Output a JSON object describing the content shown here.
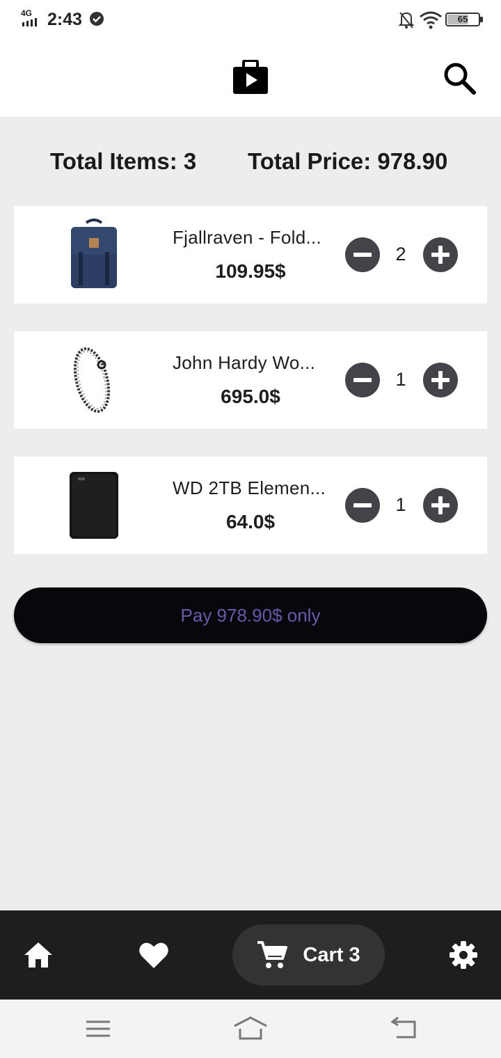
{
  "status_bar": {
    "network": "4G",
    "time": "2:43",
    "battery": "65"
  },
  "app_bar": {
    "logo_icon": "shopping-bag-play-icon",
    "search_icon": "search-icon"
  },
  "summary": {
    "total_items": "Total Items: 3",
    "total_price": "Total Price: 978.90"
  },
  "cart_items": [
    {
      "name": "Fjallraven - Fold...",
      "price": "109.95$",
      "quantity": "2",
      "thumb": "backpack-image"
    },
    {
      "name": "John Hardy Wo...",
      "price": "695.0$",
      "quantity": "1",
      "thumb": "bracelet-image"
    },
    {
      "name": "WD 2TB Elemen...",
      "price": "64.0$",
      "quantity": "1",
      "thumb": "hard-drive-image"
    }
  ],
  "pay_button": {
    "label": "Pay 978.90$ only"
  },
  "bottom_nav": {
    "home_icon": "home-icon",
    "favorites_icon": "heart-icon",
    "cart_label": "Cart 3",
    "cart_icon": "cart-icon",
    "settings_icon": "gear-icon"
  },
  "colors": {
    "accent_text": "#6a58ad",
    "qty_button": "#45424a",
    "nav_background": "#1e1e1e",
    "page_background": "#ededed"
  }
}
